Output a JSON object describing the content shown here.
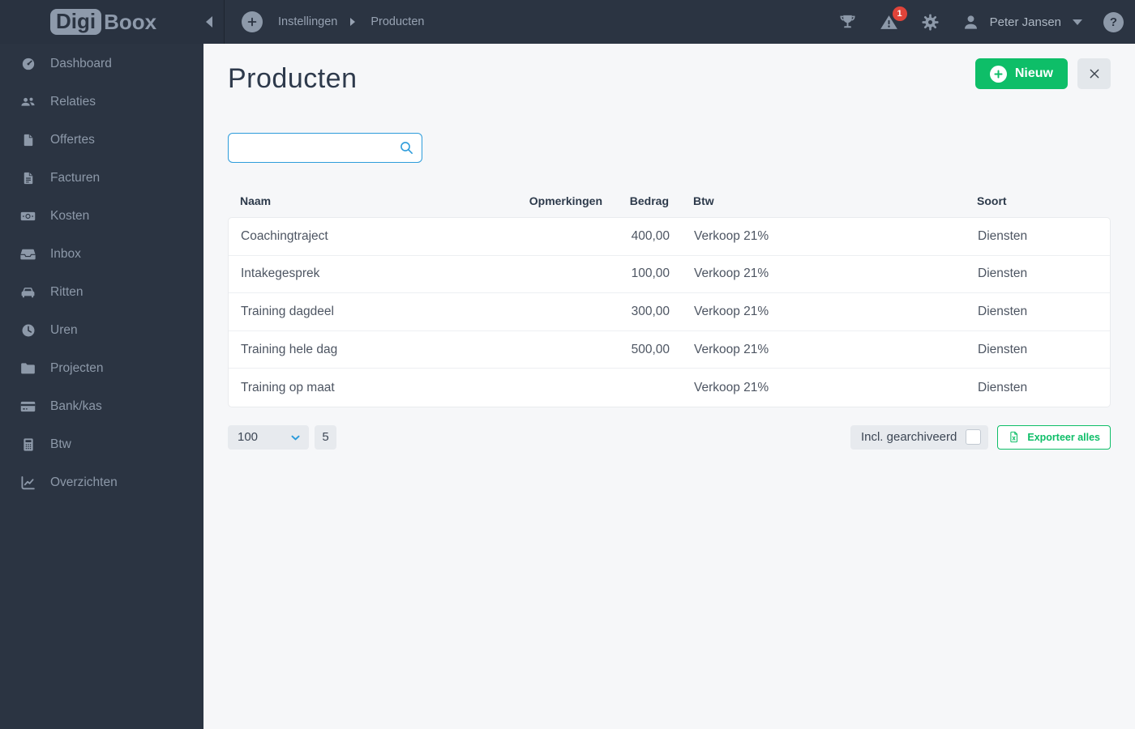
{
  "brand": {
    "logo_primary": "Digi",
    "logo_secondary": "Boox"
  },
  "topbar": {
    "breadcrumb": {
      "items": [
        "Instellingen",
        "Producten"
      ]
    },
    "notification_count": "1",
    "user_name": "Peter Jansen",
    "help_glyph": "?"
  },
  "sidebar": {
    "items": [
      {
        "label": "Dashboard",
        "icon": "gauge-icon"
      },
      {
        "label": "Relaties",
        "icon": "users-icon"
      },
      {
        "label": "Offertes",
        "icon": "file-icon"
      },
      {
        "label": "Facturen",
        "icon": "invoice-icon"
      },
      {
        "label": "Kosten",
        "icon": "money-icon"
      },
      {
        "label": "Inbox",
        "icon": "inbox-icon"
      },
      {
        "label": "Ritten",
        "icon": "car-icon"
      },
      {
        "label": "Uren",
        "icon": "clock-icon"
      },
      {
        "label": "Projecten",
        "icon": "folder-icon"
      },
      {
        "label": "Bank/kas",
        "icon": "credit-card-icon"
      },
      {
        "label": "Btw",
        "icon": "calculator-icon"
      },
      {
        "label": "Overzichten",
        "icon": "chart-line-icon"
      }
    ]
  },
  "main": {
    "title": "Producten",
    "new_button_label": "Nieuw",
    "search": {
      "value": "",
      "placeholder": ""
    },
    "table": {
      "headers": [
        "Naam",
        "Opmerkingen",
        "Bedrag",
        "Btw",
        "Soort"
      ],
      "rows": [
        {
          "naam": "Coachingtraject",
          "opmerkingen": "",
          "bedrag": "400,00",
          "btw": "Verkoop 21%",
          "soort": "Diensten"
        },
        {
          "naam": "Intakegesprek",
          "opmerkingen": "",
          "bedrag": "100,00",
          "btw": "Verkoop 21%",
          "soort": "Diensten"
        },
        {
          "naam": "Training dagdeel",
          "opmerkingen": "",
          "bedrag": "300,00",
          "btw": "Verkoop 21%",
          "soort": "Diensten"
        },
        {
          "naam": "Training hele dag",
          "opmerkingen": "",
          "bedrag": "500,00",
          "btw": "Verkoop 21%",
          "soort": "Diensten"
        },
        {
          "naam": "Training op maat",
          "opmerkingen": "",
          "bedrag": "",
          "btw": "Verkoop 21%",
          "soort": "Diensten"
        }
      ]
    },
    "footer": {
      "page_size": "100",
      "result_count": "5",
      "archived_label": "Incl. gearchiveerd",
      "archived_checked": false,
      "export_label": "Exporteer alles"
    }
  },
  "colors": {
    "topbar_dark": "#2b3442",
    "accent_green": "#0ebe68",
    "accent_blue": "#2d9cdb",
    "badge_red": "#e0443a",
    "icon_muted": "#8d99a9"
  }
}
